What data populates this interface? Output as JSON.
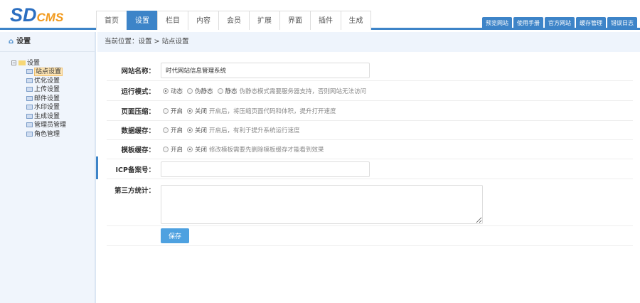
{
  "logo": {
    "sd": "SD",
    "cms": "CMS"
  },
  "nav": {
    "items": [
      "首页",
      "设置",
      "栏目",
      "内容",
      "会员",
      "扩展",
      "界面",
      "插件",
      "生成"
    ],
    "active": 1
  },
  "quick_links": [
    "预览网站",
    "使用手册",
    "官方网站",
    "缓存管理",
    "错误日志"
  ],
  "sidebar": {
    "title": "设置",
    "root": "设置",
    "items": [
      "站点设置",
      "优化设置",
      "上传设置",
      "邮件设置",
      "水印设置",
      "生成设置",
      "管理员管理",
      "角色管理"
    ],
    "selected": 0
  },
  "breadcrumb": "当前位置：设置 > 站点设置",
  "form": {
    "site_name": {
      "label": "网站名称：",
      "value": "时代网站信息管理系统"
    },
    "run_mode": {
      "label": "运行模式：",
      "options": [
        "动态",
        "伪静态",
        "静态"
      ],
      "selected": 0,
      "tip": "伪静态模式需要服务器支持，否则网站无法访问"
    },
    "compress": {
      "label": "页面压缩：",
      "options": [
        "开启",
        "关闭"
      ],
      "selected": 1,
      "tip": "开启后，将压缩页面代码和体积，提升打开速度"
    },
    "data_cache": {
      "label": "数据缓存：",
      "options": [
        "开启",
        "关闭"
      ],
      "selected": 1,
      "tip": "开启后，有利于提升系统运行速度"
    },
    "tpl_cache": {
      "label": "模板缓存：",
      "options": [
        "开启",
        "关闭"
      ],
      "selected": 1,
      "tip": "修改模板需要先删除模板缓存才能看到效果"
    },
    "icp": {
      "label": "ICP备案号：",
      "value": ""
    },
    "stats": {
      "label": "第三方统计：",
      "value": ""
    },
    "save_label": "保存"
  },
  "colors": {
    "accent": "#3d84c8",
    "button": "#4ea1e0"
  }
}
